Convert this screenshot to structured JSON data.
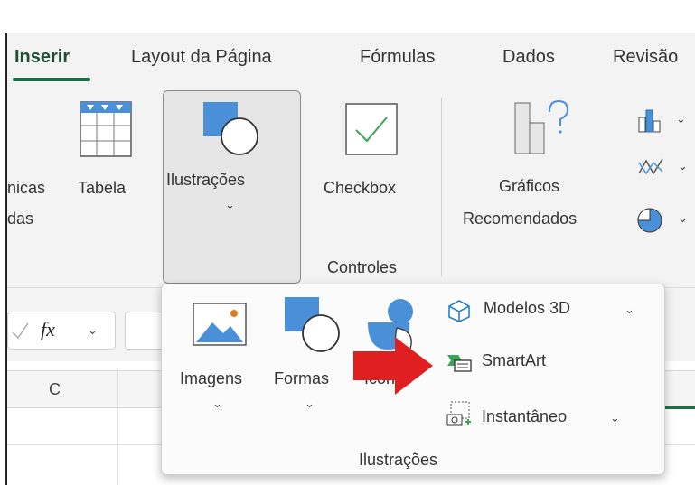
{
  "tabs": [
    "Inserir",
    "Layout da Página",
    "Fórmulas",
    "Dados",
    "Revisão"
  ],
  "ribbon": {
    "tables_partial_label_1": "nicas",
    "tables_partial_label_2": "das",
    "tabela_label": "Tabela",
    "ilustracoes_label": "Ilustrações",
    "checkbox_label": "Checkbox",
    "controles_group": "Controles",
    "graficos_label_1": "Gráficos",
    "graficos_label_2": "Recomendados",
    "chevron": "⌄"
  },
  "formula_bar": {
    "fx": "fx",
    "column_c": "C"
  },
  "popup": {
    "imagens_label": "Imagens",
    "formas_label": "Formas",
    "icones_label": "Ícones",
    "modelos3d_label": "Modelos 3D",
    "smartart_label": "SmartArt",
    "instantaneo_label": "Instantâneo",
    "group_label": "Ilustrações"
  },
  "colors": {
    "accent_green": "#1e7145",
    "icon_blue": "#4a90d9",
    "arrow_red": "#e02020"
  }
}
